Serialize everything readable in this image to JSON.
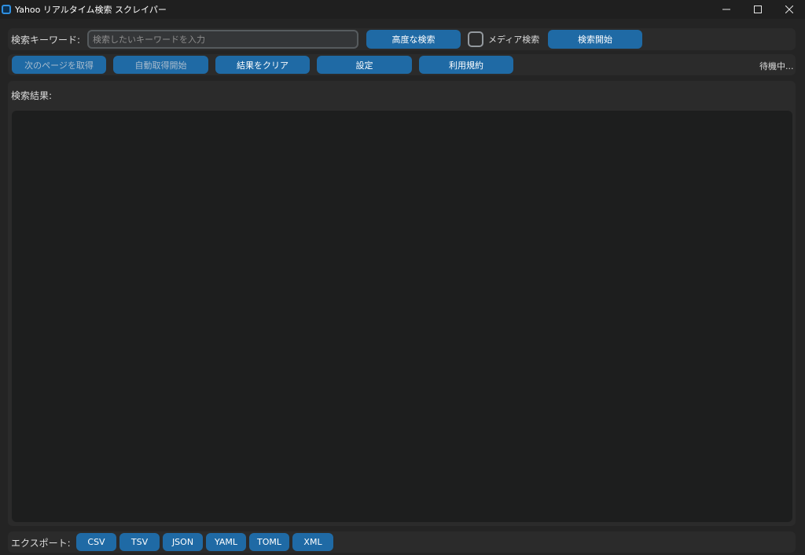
{
  "window": {
    "title": "Yahoo リアルタイム検索 スクレイパー",
    "icon": "app-window-icon",
    "controls": [
      "minimize-icon",
      "maximize-icon",
      "close-icon"
    ]
  },
  "search_row": {
    "keyword_label": "検索キーワード:",
    "keyword_placeholder": "検索したいキーワードを入力",
    "keyword_value": "",
    "advanced_button": "高度な検索",
    "media_checkbox_label": "メディア検索",
    "media_checked": false,
    "start_button": "検索開始"
  },
  "action_row": {
    "next_page_button": "次のページを取得",
    "auto_fetch_button": "自動取得開始",
    "clear_button": "結果をクリア",
    "settings_button": "設定",
    "terms_button": "利用規約",
    "status": "待機中..."
  },
  "results": {
    "label": "検索結果:",
    "content": ""
  },
  "export_row": {
    "label": "エクスポート:",
    "formats": [
      "CSV",
      "TSV",
      "JSON",
      "YAML",
      "TOML",
      "XML"
    ]
  },
  "colors": {
    "accent": "#1f6aa5",
    "background": "#242424",
    "frame": "#2b2b2b",
    "textbox": "#1d1e1e"
  }
}
